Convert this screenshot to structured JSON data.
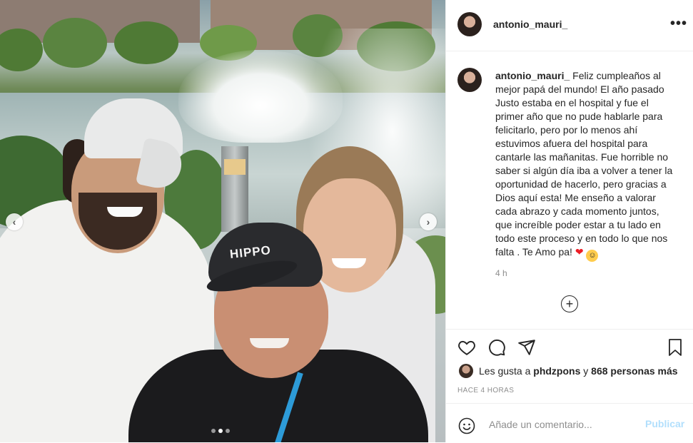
{
  "photo": {
    "cap_text": "HIPPO",
    "carousel": {
      "prev": "‹",
      "next": "›",
      "slides": 3,
      "active_slide": 2
    }
  },
  "post": {
    "username": "antonio_mauri_",
    "more": "•••",
    "caption_user": "antonio_mauri_",
    "caption_text": " Feliz cumpleaños al mejor papá del mundo! El año pasado Justo estaba en el hospital y fue el primer año que no pude hablarle para felicitarlo, pero por lo menos ahí estuvimos afuera del hospital para cantarle las mañanitas. Fue horrible no saber si algún día iba a volver a tener la oportunidad de hacerlo, pero gracias a Dios aquí esta! Me enseño a valorar cada abrazo y cada momento juntos, que increíble poder estar a tu lado en todo este proceso y en todo lo que nos falta . Te Amo pa! ",
    "caption_heart": "❤",
    "caption_emoji": "☺",
    "time": "4 h",
    "more_comments": "+"
  },
  "likes": {
    "prefix": "Les gusta a ",
    "user": "phdzpons",
    "middle": " y ",
    "count": "868 personas más"
  },
  "timestamp": "HACE 4 HORAS",
  "comment": {
    "placeholder": "Añade un comentario...",
    "publish": "Publicar"
  },
  "icons": [
    "heart-icon",
    "comment-icon",
    "share-icon",
    "bookmark-icon",
    "emoji-icon",
    "more-options-icon"
  ]
}
